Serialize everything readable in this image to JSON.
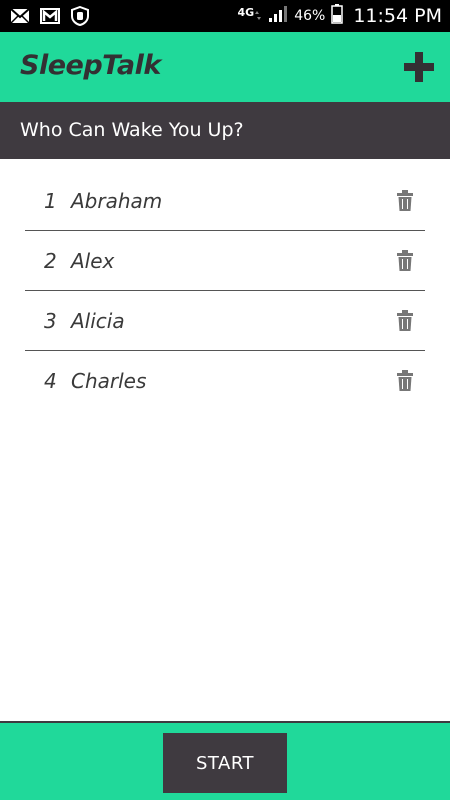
{
  "status_bar": {
    "network_type": "4G",
    "battery_percent": "46%",
    "time": "11:54 PM",
    "left_icons": [
      "mail-icon",
      "gmail-icon",
      "shield-hand-icon"
    ],
    "right_icons": [
      "data-arrows-icon",
      "signal-icon",
      "battery-icon"
    ]
  },
  "app_bar": {
    "title": "SleepTalk",
    "add_icon": "plus-icon",
    "background_color": "#20d99a"
  },
  "section": {
    "title": "Who Can Wake You Up?",
    "background_color": "#3f3a40"
  },
  "contacts": [
    {
      "index": "1",
      "name": "Abraham",
      "delete_icon": "trash-icon"
    },
    {
      "index": "2",
      "name": "Alex",
      "delete_icon": "trash-icon"
    },
    {
      "index": "3",
      "name": "Alicia",
      "delete_icon": "trash-icon"
    },
    {
      "index": "4",
      "name": "Charles",
      "delete_icon": "trash-icon"
    }
  ],
  "footer": {
    "start_label": "START"
  }
}
